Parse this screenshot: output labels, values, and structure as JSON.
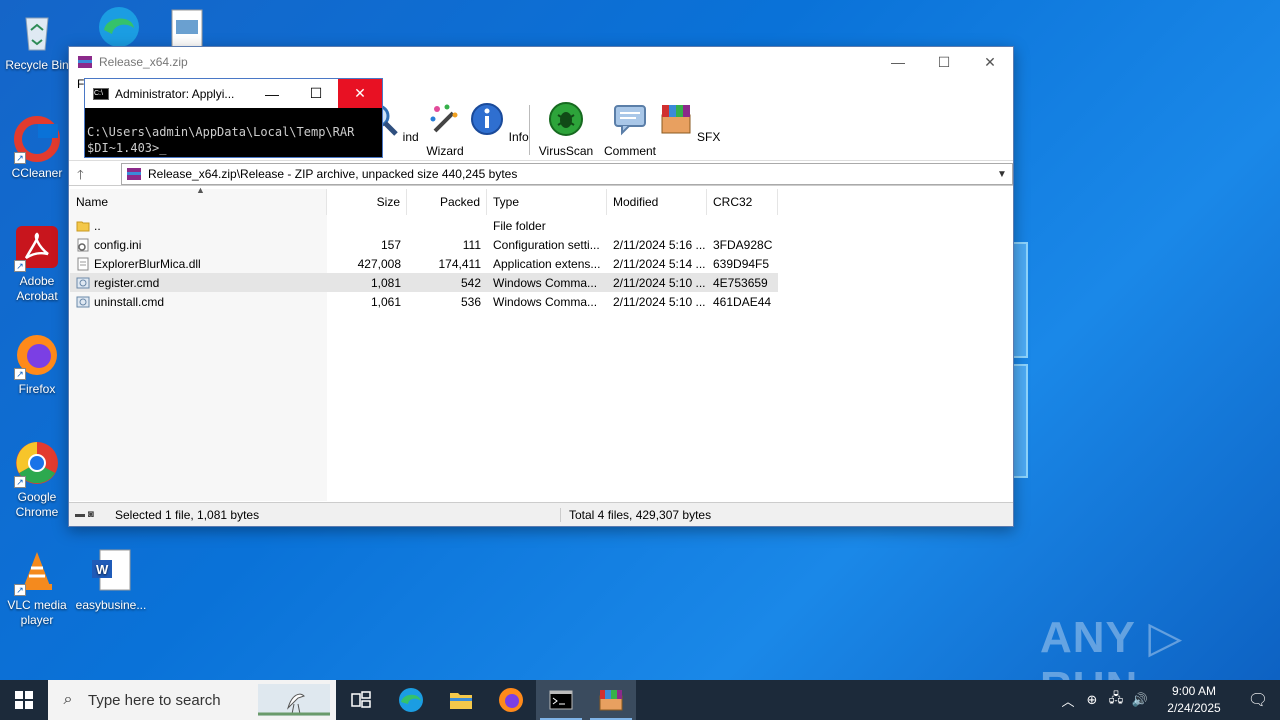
{
  "desktop": {
    "icons": [
      {
        "label": "Recycle Bin"
      },
      {
        "label": "CCleaner"
      },
      {
        "label": "Adobe Acrobat"
      },
      {
        "label": "Firefox"
      },
      {
        "label": "Google Chrome"
      },
      {
        "label": "VLC media player"
      },
      {
        "label": "easybusine..."
      }
    ],
    "watermark": "ANY ▷ RUN"
  },
  "winrar": {
    "title": "Release_x64.zip",
    "menu_partial": "Fi",
    "toolbar": {
      "find_partial": "ind",
      "wizard": "Wizard",
      "info": "Info",
      "virusscan": "VirusScan",
      "comment": "Comment",
      "sfx": "SFX"
    },
    "address": "Release_x64.zip\\Release - ZIP archive, unpacked size 440,245 bytes",
    "columns": {
      "name": "Name",
      "size": "Size",
      "packed": "Packed",
      "type": "Type",
      "modified": "Modified",
      "crc": "CRC32"
    },
    "rows": [
      {
        "name": "..",
        "size": "",
        "packed": "",
        "type": "File folder",
        "modified": "",
        "crc": ""
      },
      {
        "name": "config.ini",
        "size": "157",
        "packed": "111",
        "type": "Configuration setti...",
        "modified": "2/11/2024 5:16 ...",
        "crc": "3FDA928C"
      },
      {
        "name": "ExplorerBlurMica.dll",
        "size": "427,008",
        "packed": "174,411",
        "type": "Application extens...",
        "modified": "2/11/2024 5:14 ...",
        "crc": "639D94F5"
      },
      {
        "name": "register.cmd",
        "size": "1,081",
        "packed": "542",
        "type": "Windows Comma...",
        "modified": "2/11/2024 5:10 ...",
        "crc": "4E753659"
      },
      {
        "name": "uninstall.cmd",
        "size": "1,061",
        "packed": "536",
        "type": "Windows Comma...",
        "modified": "2/11/2024 5:10 ...",
        "crc": "461DAE44"
      }
    ],
    "status_left": "Selected 1 file, 1,081 bytes",
    "status_right": "Total 4 files, 429,307 bytes"
  },
  "console": {
    "title": "Administrator: Applyi...",
    "line1": "C:\\Users\\admin\\AppData\\Local\\Temp\\RAR",
    "line2": "$DI~1.403>_"
  },
  "taskbar": {
    "search_placeholder": "Type here to search",
    "time": "9:00 AM",
    "date": "2/24/2025"
  }
}
